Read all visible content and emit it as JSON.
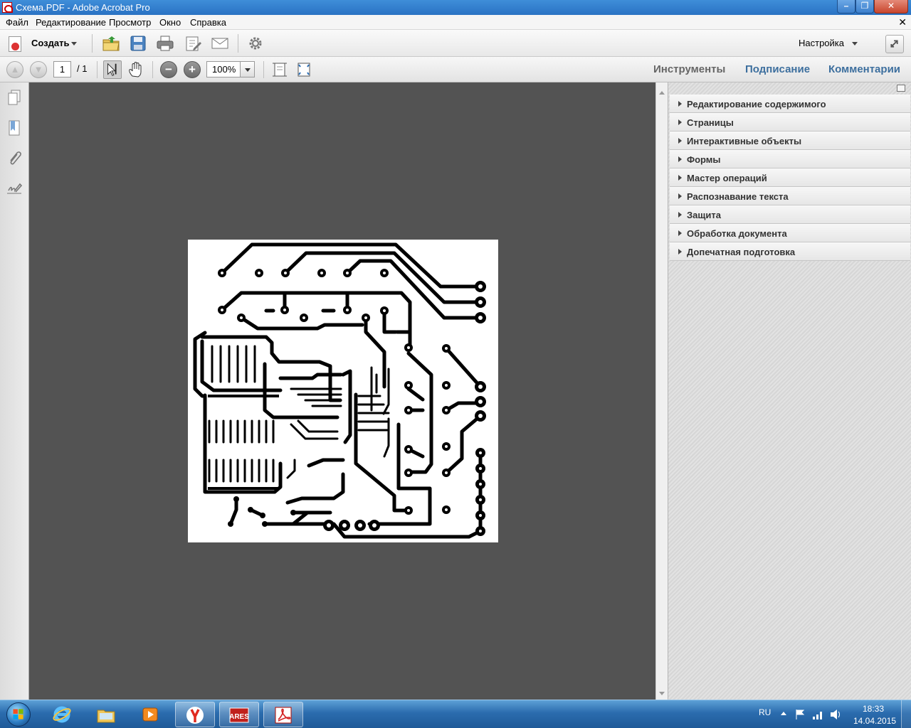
{
  "window": {
    "title": "Схема.PDF - Adobe Acrobat Pro"
  },
  "menu": {
    "items": [
      "Файл",
      "Редактирование",
      "Просмотр",
      "Окно",
      "Справка"
    ]
  },
  "toolbar": {
    "create_label": "Создать",
    "customize_label": "Настройка"
  },
  "navigation": {
    "current_page": "1",
    "total_pages": "/ 1",
    "zoom": "100%"
  },
  "pane_tabs": [
    "Инструменты",
    "Подписание",
    "Комментарии"
  ],
  "tool_panels": [
    "Редактирование содержимого",
    "Страницы",
    "Интерактивные объекты",
    "Формы",
    "Мастер операций",
    "Распознавание текста",
    "Защита",
    "Обработка документа",
    "Допечатная подготовка"
  ],
  "taskbar": {
    "lang": "RU",
    "time": "18:33",
    "date": "14.04.2015",
    "apps": [
      "internet-explorer",
      "windows-explorer",
      "media-player",
      "yandex-browser",
      "ares",
      "adobe-acrobat"
    ],
    "ares_label": "ARES"
  },
  "colors": {
    "doc_background": "#535353",
    "accent_tab": "#3d6f9e",
    "taskbar": "#2b6cae"
  }
}
